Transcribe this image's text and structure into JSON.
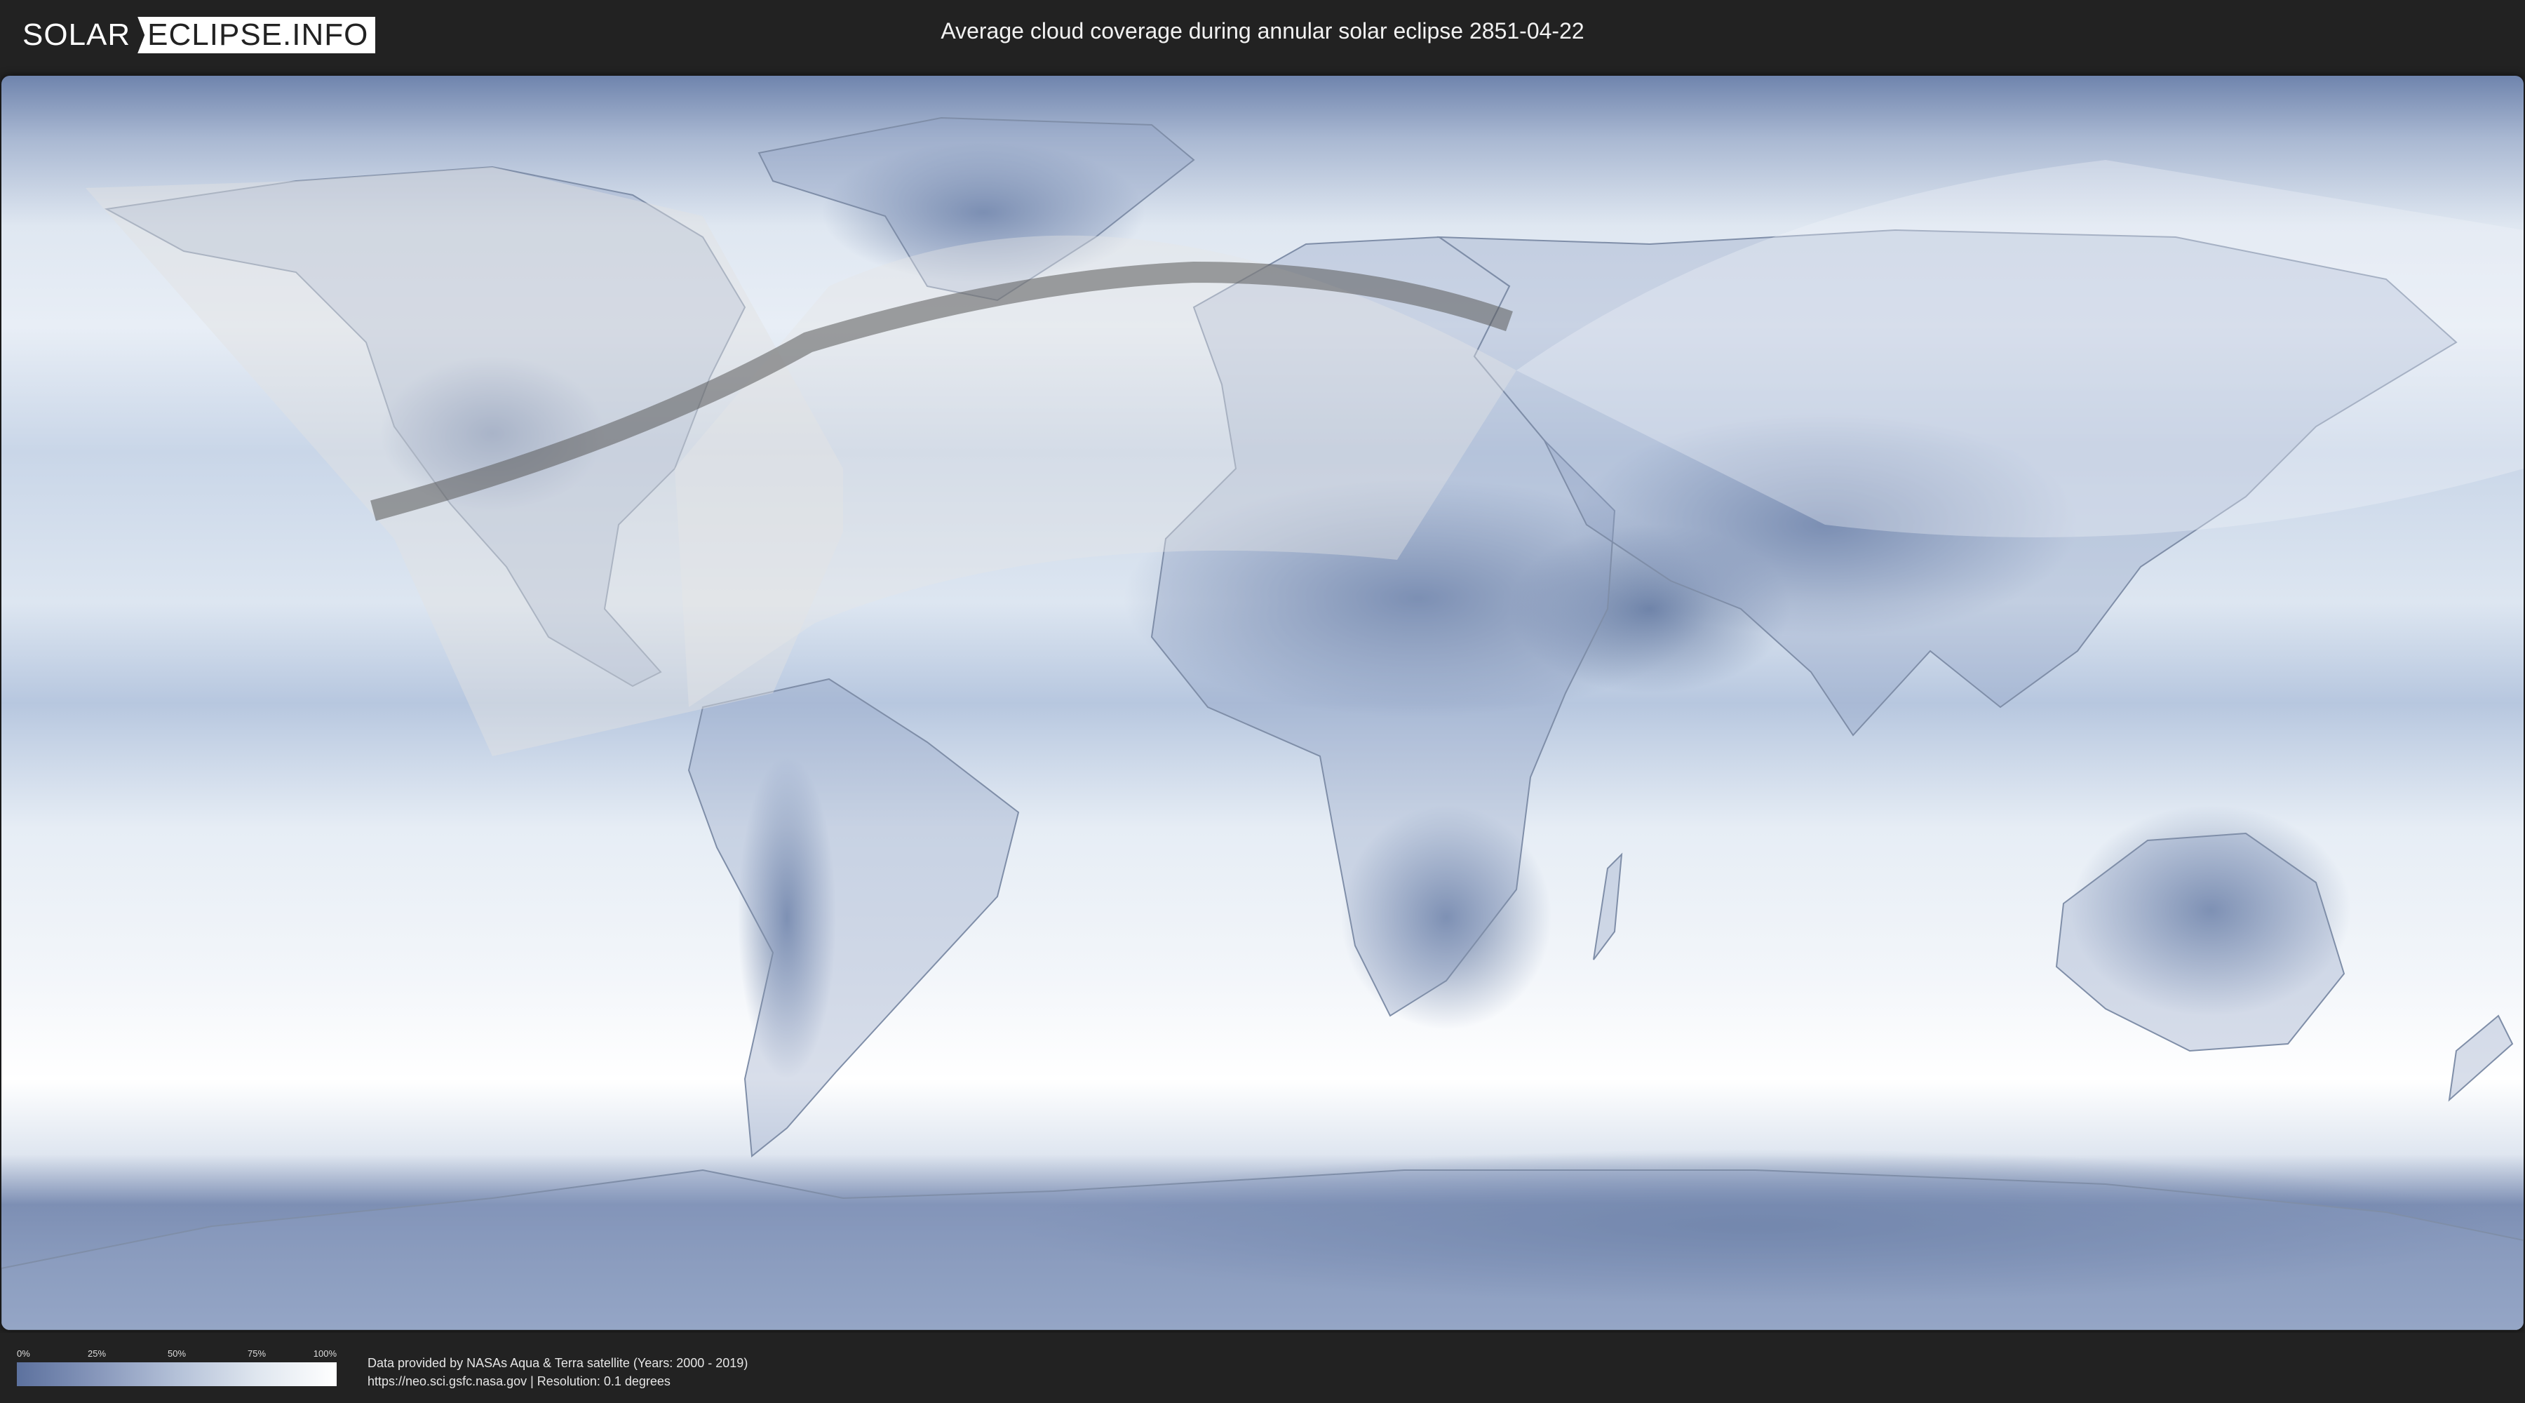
{
  "header": {
    "logo_left": "SOLAR",
    "logo_right": "ECLIPSE.INFO",
    "title": "Average cloud coverage during annular solar eclipse 2851-04-22"
  },
  "legend": {
    "ticks": [
      "0%",
      "25%",
      "50%",
      "75%",
      "100%"
    ],
    "gradient_colors": [
      "#5c719e",
      "#8797bb",
      "#b4c1d8",
      "#dfe6ef",
      "#ffffff"
    ]
  },
  "credit": {
    "line1": "Data provided by NASAs Aqua & Terra satellite (Years: 2000 - 2019)",
    "line2": "https://neo.sci.gsfc.nasa.gov | Resolution: 0.1 degrees"
  },
  "map": {
    "projection": "equirectangular",
    "colors": {
      "clear_sky": "#5c719e",
      "cloudy": "#ffffff",
      "land_outline": "#7f8ea8",
      "eclipse_path": "#5a5a5a",
      "penumbra": "#d8d8d8"
    }
  }
}
